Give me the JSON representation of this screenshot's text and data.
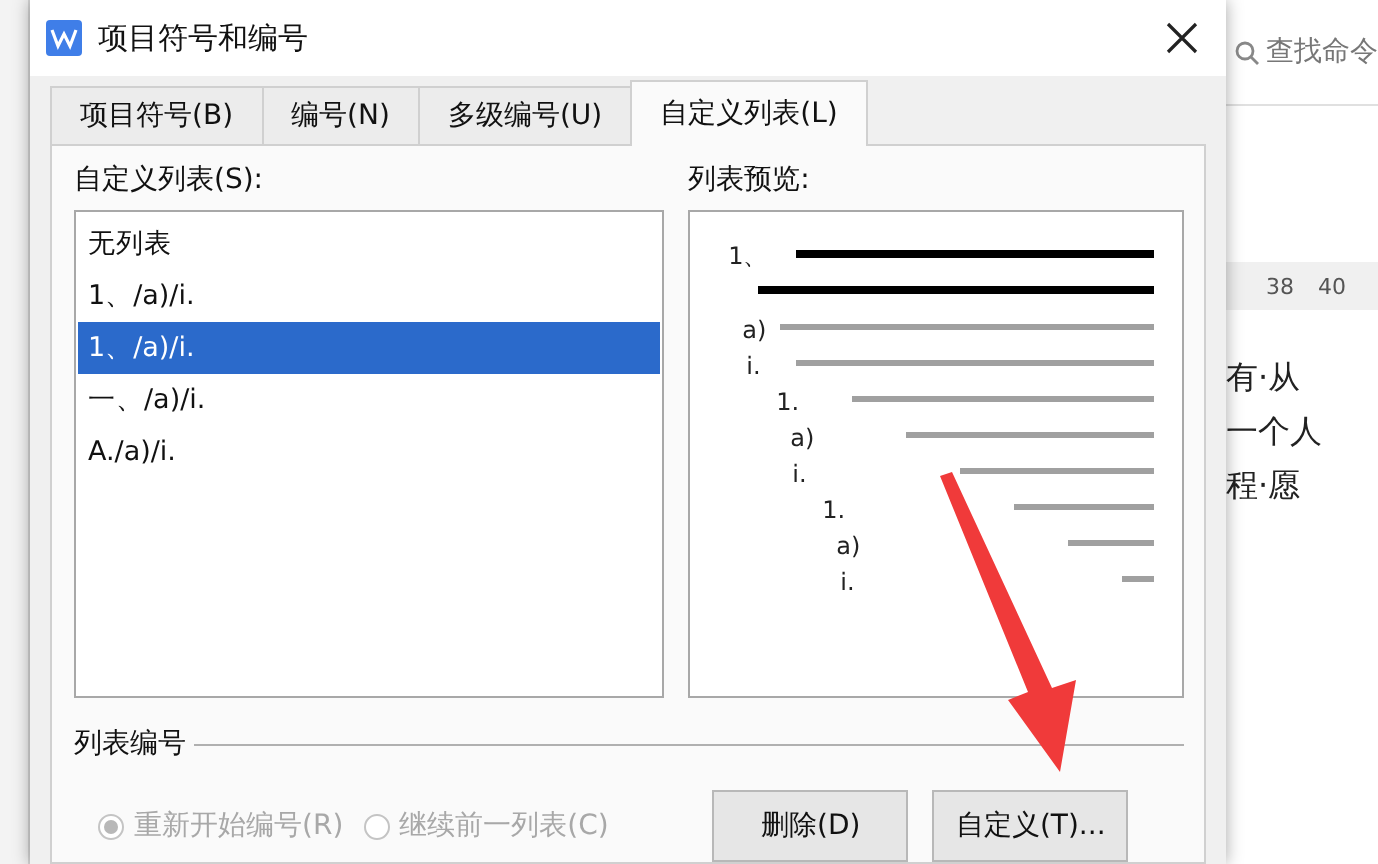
{
  "window": {
    "title": "项目符号和编号"
  },
  "tabs": [
    {
      "label": "项目符号(B)",
      "selected": false
    },
    {
      "label": "编号(N)",
      "selected": false
    },
    {
      "label": "多级编号(U)",
      "selected": false
    },
    {
      "label": "自定义列表(L)",
      "selected": true
    }
  ],
  "custom_list": {
    "label": "自定义列表(S):",
    "items": [
      {
        "label": "无列表",
        "selected": false
      },
      {
        "label": "1、/a)/i.",
        "selected": false
      },
      {
        "label": "1、/a)/i.",
        "selected": true
      },
      {
        "label": "一、/a)/i.",
        "selected": false
      },
      {
        "label": "A./a)/i.",
        "selected": false
      }
    ]
  },
  "preview": {
    "label": "列表预览:",
    "lines": [
      {
        "label": "1、",
        "kind": "dark"
      },
      {
        "kind": "dark"
      },
      {
        "label": "a)",
        "kind": "light"
      },
      {
        "label": "i.",
        "kind": "light"
      },
      {
        "label": "1.",
        "kind": "light"
      },
      {
        "label": "a)",
        "kind": "light"
      },
      {
        "label": "i.",
        "kind": "light"
      },
      {
        "label": "1.",
        "kind": "light"
      },
      {
        "label": "a)",
        "kind": "light"
      },
      {
        "label": "i.",
        "kind": "light"
      }
    ]
  },
  "numbering": {
    "label": "列表编号",
    "options": [
      {
        "label": "重新开始编号(R)",
        "selected": true,
        "disabled": true
      },
      {
        "label": "继续前一列表(C)",
        "selected": false,
        "disabled": true
      }
    ]
  },
  "buttons": [
    "删除(D)",
    "自定义(T)..."
  ],
  "background": {
    "search": {
      "placeholder": "查找命令"
    },
    "ruler": [
      "38",
      "40"
    ],
    "text_lines": [
      "有·从",
      "一个人",
      "程·愿"
    ]
  }
}
